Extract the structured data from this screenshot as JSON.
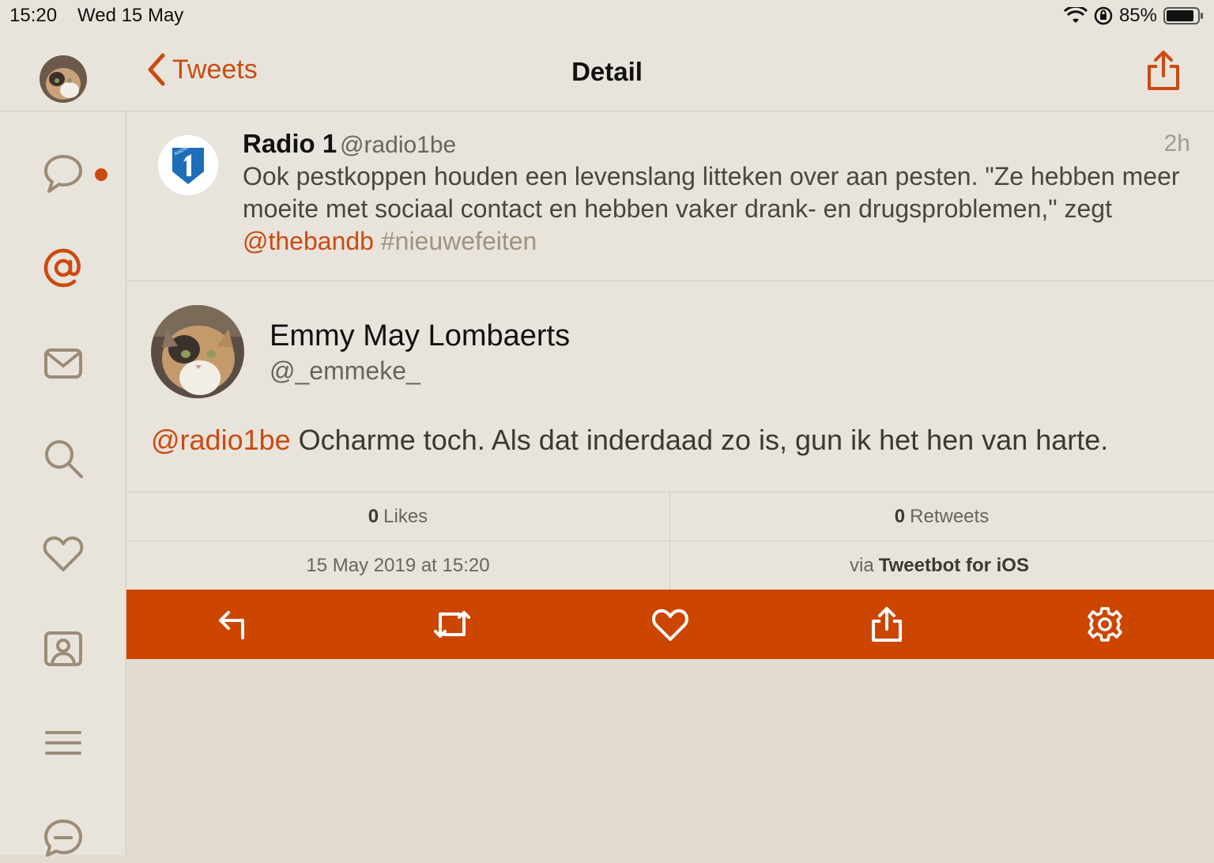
{
  "status_bar": {
    "time": "15:20",
    "date": "Wed 15 May",
    "battery": "85%"
  },
  "nav": {
    "back_label": "Tweets",
    "title": "Detail"
  },
  "sidebar": {
    "items": [
      "timeline-icon",
      "mentions-icon",
      "messages-icon",
      "search-icon",
      "likes-icon",
      "profile-icon",
      "lists-icon",
      "conversations-icon"
    ]
  },
  "parent_tweet": {
    "name": "Radio 1",
    "handle": "@radio1be",
    "time": "2h",
    "text": "Ook pestkoppen houden een levenslang litteken over aan pesten. \"Ze hebben meer moeite met sociaal contact en hebben vaker drank- en drugsproblemen,\" zegt ",
    "mention": "@thebandb",
    "hashtag": "#nieuwefeiten"
  },
  "tweet": {
    "name": "Emmy May Lombaerts",
    "handle": "@_emmeke_",
    "mention": "@radio1be",
    "text": " Ocharme toch. Als dat inderdaad zo is, gun ik het hen van harte."
  },
  "stats": {
    "likes_count": "0",
    "likes_label": "Likes",
    "retweets_count": "0",
    "retweets_label": "Retweets",
    "date": "15 May 2019 at 15:20",
    "via_label": "via",
    "client": "Tweetbot for iOS"
  },
  "colors": {
    "accent": "#cc4a10",
    "action_bar": "#cc4600",
    "background": "#e1dbd1"
  }
}
